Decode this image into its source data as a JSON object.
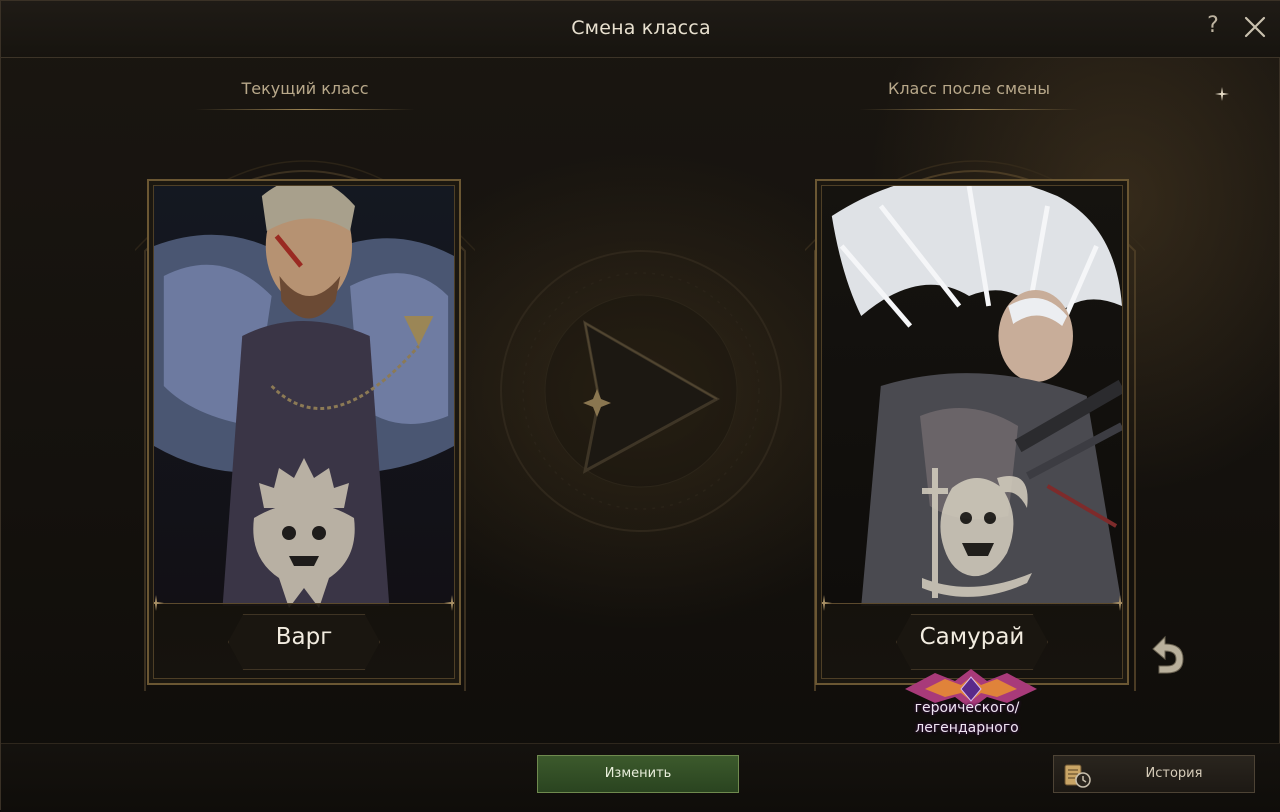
{
  "window": {
    "title": "Смена класса",
    "help_label": "?"
  },
  "current": {
    "section_label": "Текущий класс",
    "class_name": "Варг"
  },
  "target": {
    "section_label": "Класс после смены",
    "class_name": "Самурай",
    "rank_line1": "героического/",
    "rank_line2": "легендарного"
  },
  "actions": {
    "change_label": "Изменить",
    "history_label": "История"
  },
  "colors": {
    "accent_gold": "#b8a88a",
    "change_button": "#3c5a2c"
  },
  "icons": {
    "close": "close-icon",
    "help": "question-icon",
    "undo": "undo-arrow-icon",
    "history": "scroll-clock-icon",
    "arrow": "play-arrow-icon"
  }
}
